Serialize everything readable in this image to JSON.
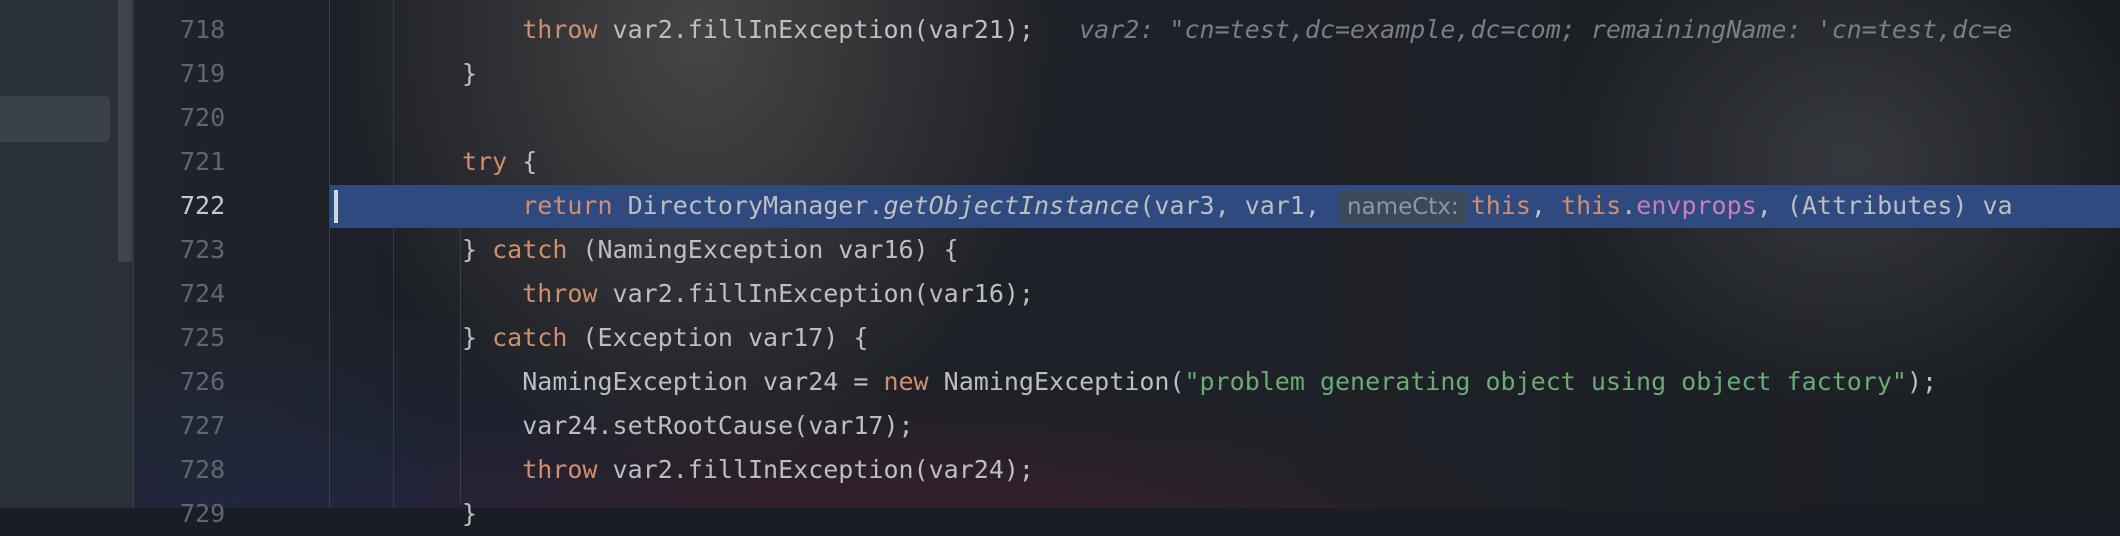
{
  "editor": {
    "lines": [
      {
        "num": "718",
        "indent": "    ",
        "tokens": [
          {
            "t": "kw",
            "v": "throw"
          },
          {
            "t": "p",
            "v": " var2.fillInException(var21);   "
          },
          {
            "t": "hint",
            "v": "var2: \"cn=test,dc=example,dc=com; remainingName: 'cn=test,dc=e"
          }
        ]
      },
      {
        "num": "719",
        "indent": "",
        "tokens": [
          {
            "t": "p",
            "v": "}"
          }
        ]
      },
      {
        "num": "720",
        "indent": "",
        "tokens": []
      },
      {
        "num": "721",
        "indent": "",
        "tokens": [
          {
            "t": "kw",
            "v": "try"
          },
          {
            "t": "p",
            "v": " {"
          }
        ]
      },
      {
        "num": "722",
        "indent": "    ",
        "current": true,
        "tokens": [
          {
            "t": "kw",
            "v": "return"
          },
          {
            "t": "p",
            "v": " DirectoryManager."
          },
          {
            "t": "it",
            "v": "getObjectInstance"
          },
          {
            "t": "p",
            "v": "(var3, var1, "
          },
          {
            "t": "inlay",
            "v": "nameCtx:"
          },
          {
            "t": "kw",
            "v": "this"
          },
          {
            "t": "p",
            "v": ", "
          },
          {
            "t": "kw",
            "v": "this"
          },
          {
            "t": "p",
            "v": "."
          },
          {
            "t": "fld",
            "v": "envprops"
          },
          {
            "t": "p",
            "v": ", (Attributes) va"
          }
        ]
      },
      {
        "num": "723",
        "indent": "",
        "tokens": [
          {
            "t": "p",
            "v": "} "
          },
          {
            "t": "kw",
            "v": "catch"
          },
          {
            "t": "p",
            "v": " (NamingException var16) {"
          }
        ]
      },
      {
        "num": "724",
        "indent": "    ",
        "tokens": [
          {
            "t": "kw",
            "v": "throw"
          },
          {
            "t": "p",
            "v": " var2.fillInException(var16);"
          }
        ]
      },
      {
        "num": "725",
        "indent": "",
        "tokens": [
          {
            "t": "p",
            "v": "} "
          },
          {
            "t": "kw",
            "v": "catch"
          },
          {
            "t": "p",
            "v": " (Exception var17) {"
          }
        ]
      },
      {
        "num": "726",
        "indent": "    ",
        "tokens": [
          {
            "t": "p",
            "v": "NamingException var24 = "
          },
          {
            "t": "kw",
            "v": "new"
          },
          {
            "t": "p",
            "v": " NamingException("
          },
          {
            "t": "str",
            "v": "\"problem generating object using object factory\""
          },
          {
            "t": "p",
            "v": ");"
          }
        ]
      },
      {
        "num": "727",
        "indent": "    ",
        "tokens": [
          {
            "t": "p",
            "v": "var24.setRootCause(var17);"
          }
        ]
      },
      {
        "num": "728",
        "indent": "    ",
        "tokens": [
          {
            "t": "kw",
            "v": "throw"
          },
          {
            "t": "p",
            "v": " var2.fillInException(var24);"
          }
        ]
      },
      {
        "num": "729",
        "indent": "",
        "tokens": [
          {
            "t": "p",
            "v": "}"
          }
        ]
      }
    ]
  },
  "colors": {
    "keyword": "#cf8e6d",
    "string": "#6aab73",
    "field": "#c77dbb",
    "current_line": "#2f4a7e"
  }
}
